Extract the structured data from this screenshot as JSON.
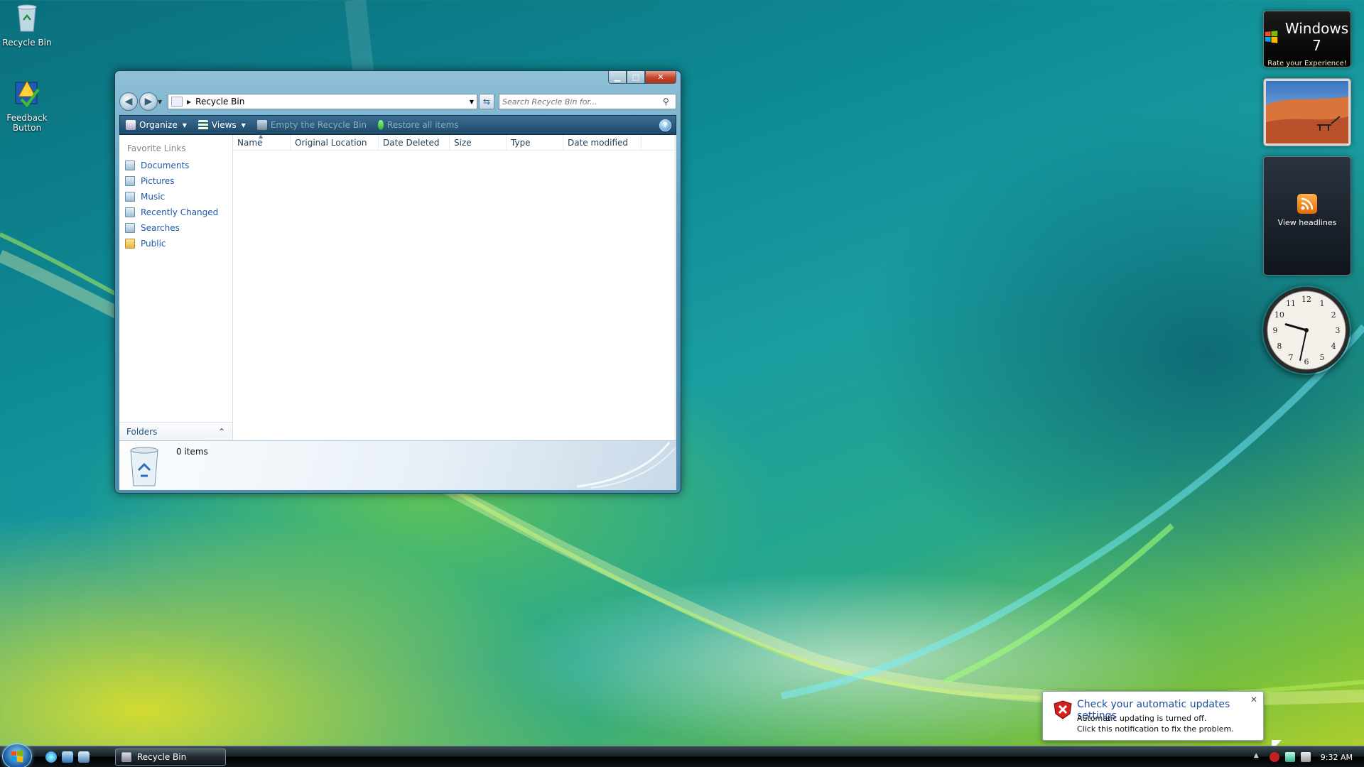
{
  "desktop": {
    "icons": [
      {
        "label": "Recycle Bin"
      },
      {
        "label": "Feedback Button"
      }
    ]
  },
  "window": {
    "address": {
      "location": "Recycle Bin"
    },
    "search": {
      "placeholder": "Search Recycle Bin for..."
    },
    "toolbar": {
      "organize": "Organize",
      "views": "Views",
      "empty": "Empty the Recycle Bin",
      "restore": "Restore all items",
      "help": "?"
    },
    "nav": {
      "title": "Favorite Links",
      "items": [
        "Documents",
        "Pictures",
        "Music",
        "Recently Changed",
        "Searches",
        "Public"
      ],
      "folders": "Folders"
    },
    "columns": [
      "Name",
      "Original Location",
      "Date Deleted",
      "Size",
      "Type",
      "Date modified"
    ],
    "details": {
      "count": "0 items"
    }
  },
  "gadgets": {
    "rate": {
      "title": "Windows 7",
      "subtitle": "Rate your Experience!"
    },
    "feed": {
      "label": "View headlines"
    },
    "clock": {
      "hour": 9,
      "minute": 32
    }
  },
  "taskbar": {
    "task": "Recycle Bin",
    "time": "9:32 AM"
  },
  "notification": {
    "title": "Check your automatic updates settings",
    "line1": "Automatic updating is turned off.",
    "line2": "Click this notification to fix the problem."
  },
  "colors": {
    "toolbar": "#1d4868",
    "link": "#1d5aa8",
    "close": "#c4432a",
    "rss": "#e46a0a"
  }
}
